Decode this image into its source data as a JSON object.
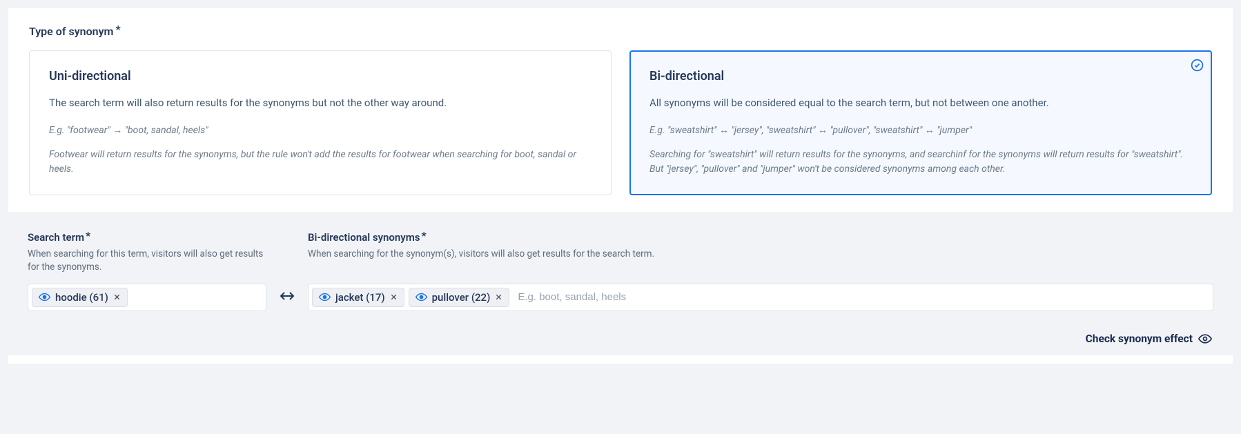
{
  "section_title": "Type of synonym",
  "cards": {
    "uni": {
      "title": "Uni-directional",
      "desc": "The search term will also return results for the synonyms but not the other way around.",
      "example1": "E.g. \"footwear\" → \"boot, sandal, heels\"",
      "example2": "Footwear will return results for the synonyms, but the rule won't add the results for footwear when searching for boot, sandal or heels."
    },
    "bi": {
      "title": "Bi-directional",
      "desc": "All synonyms will be considered equal to the search term, but not between one another.",
      "example1": "E.g. \"sweatshirt\" ↔ \"jersey\", \"sweatshirt\" ↔ \"pullover\", \"sweatshirt\" ↔ \"jumper\"",
      "example2": "Searching for \"sweatshirt\" will return results for the synonyms, and searchinf for the synonyms will return results for \"sweatshirt\". But \"jersey\", \"pullover\" and \"jumper\" won't be considered synonyms among each other."
    }
  },
  "search_term": {
    "label": "Search term",
    "help": "When searching for this term, visitors will also get results for the synonyms.",
    "token": "hoodie (61)"
  },
  "synonyms": {
    "label": "Bi-directional synonyms",
    "help": "When searching for the synonym(s), visitors will also get results for the search term.",
    "tokens": [
      "jacket (17)",
      "pullover (22)"
    ],
    "placeholder": "E.g. boot, sandal, heels"
  },
  "footer_link": "Check synonym effect"
}
